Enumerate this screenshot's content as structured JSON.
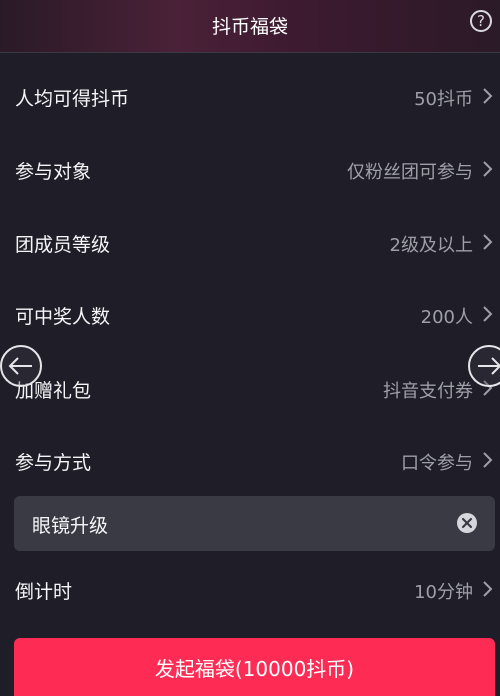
{
  "header": {
    "title": "抖币福袋",
    "help_glyph": "?"
  },
  "rows": [
    {
      "label": "人均可得抖币",
      "value": "50抖币"
    },
    {
      "label": "参与对象",
      "value": "仅粉丝团可参与"
    },
    {
      "label": "团成员等级",
      "value": "2级及以上"
    },
    {
      "label": "可中奖人数",
      "value": "200人"
    },
    {
      "label": "加赠礼包",
      "value": "抖音支付券"
    },
    {
      "label": "参与方式",
      "value": "口令参与"
    }
  ],
  "passphrase": {
    "value": "眼镜升级"
  },
  "countdown": {
    "label": "倒计时",
    "value": "10分钟"
  },
  "submit_label": "发起福袋(10000抖币)",
  "colors": {
    "background": "#1f1e28",
    "accent": "#fe2c55",
    "input_bg": "#3a3a45",
    "secondary_text": "#9f9fa8"
  }
}
